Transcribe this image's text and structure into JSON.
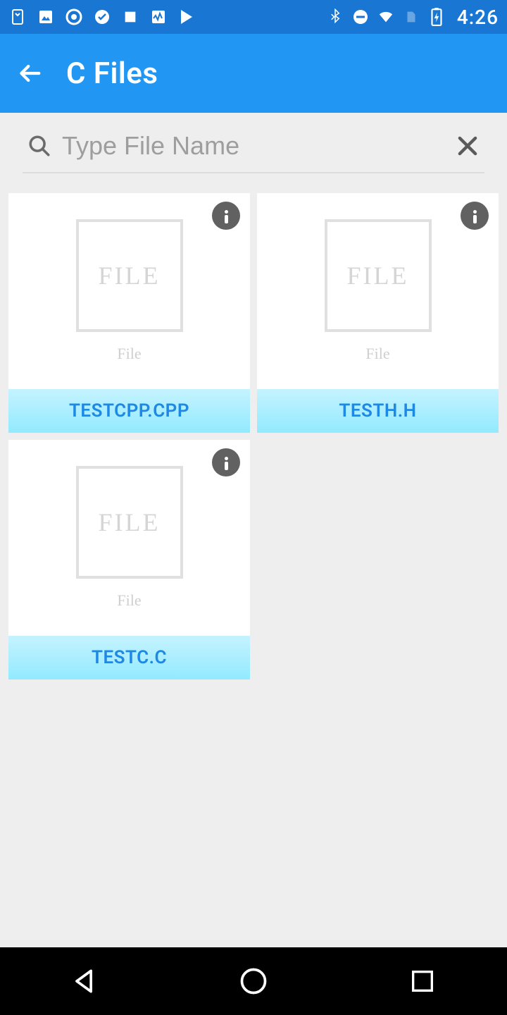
{
  "status": {
    "clock": "4:26"
  },
  "appbar": {
    "title": "C Files"
  },
  "search": {
    "placeholder": "Type File Name",
    "value": ""
  },
  "thumb": {
    "label": "FILE",
    "caption": "File"
  },
  "files": [
    {
      "name": "TESTCPP.CPP"
    },
    {
      "name": "TESTH.H"
    },
    {
      "name": "TESTC.C"
    }
  ]
}
